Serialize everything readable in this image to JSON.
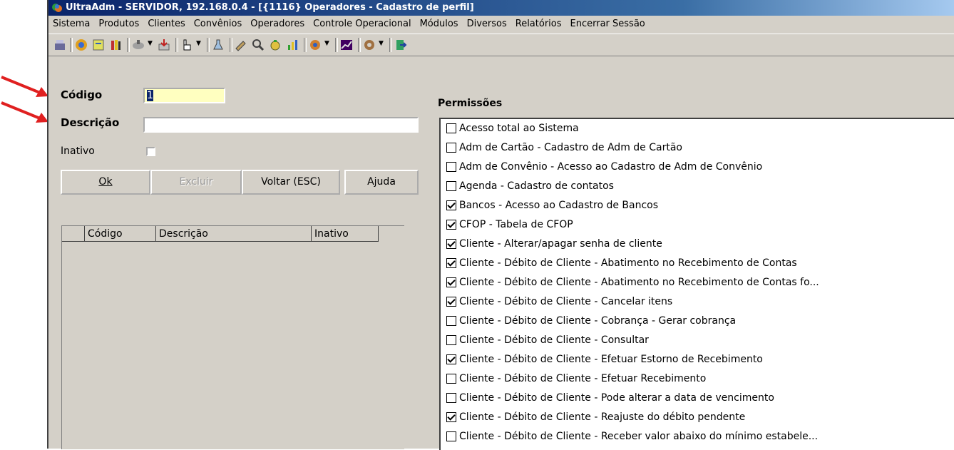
{
  "window": {
    "title": "UltraAdm - SERVIDOR, 192.168.0.4 - [{1116} Operadores - Cadastro de perfil]"
  },
  "menu": [
    "Sistema",
    "Produtos",
    "Clientes",
    "Convênios",
    "Operadores",
    "Controle Operacional",
    "Módulos",
    "Diversos",
    "Relatórios",
    "Encerrar Sessão"
  ],
  "form": {
    "codigo_label": "Código",
    "codigo_value": "1",
    "descricao_label": "Descrição",
    "descricao_value": "",
    "inativo_label": "Inativo",
    "inativo_checked": false
  },
  "buttons": {
    "ok": "Ok",
    "excluir": "Excluir",
    "voltar": "Voltar (ESC)",
    "ajuda": "Ajuda"
  },
  "grid": {
    "columns": [
      "Código",
      "Descrição",
      "Inativo"
    ]
  },
  "permissions": {
    "title": "Permissões",
    "items": [
      {
        "label": "Acesso total ao Sistema",
        "checked": false
      },
      {
        "label": "Adm de Cartão - Cadastro de Adm de Cartão",
        "checked": false
      },
      {
        "label": "Adm de Convênio - Acesso ao Cadastro de Adm de Convênio",
        "checked": false
      },
      {
        "label": "Agenda - Cadastro de contatos",
        "checked": false
      },
      {
        "label": "Bancos -  Acesso ao Cadastro de Bancos",
        "checked": true
      },
      {
        "label": "CFOP - Tabela de CFOP",
        "checked": true
      },
      {
        "label": "Cliente - Alterar/apagar senha de cliente",
        "checked": true
      },
      {
        "label": "Cliente - Débito de Cliente - Abatimento no Recebimento de Contas",
        "checked": true
      },
      {
        "label": "Cliente - Débito de Cliente - Abatimento no Recebimento de Contas fo...",
        "checked": true
      },
      {
        "label": "Cliente - Débito de Cliente - Cancelar itens",
        "checked": true
      },
      {
        "label": "Cliente - Débito de Cliente - Cobrança - Gerar cobrança",
        "checked": false
      },
      {
        "label": "Cliente - Débito de Cliente - Consultar",
        "checked": false
      },
      {
        "label": "Cliente - Débito de Cliente - Efetuar Estorno de Recebimento",
        "checked": true
      },
      {
        "label": "Cliente - Débito de Cliente - Efetuar Recebimento",
        "checked": false
      },
      {
        "label": "Cliente - Débito de Cliente - Pode alterar a data de vencimento",
        "checked": false
      },
      {
        "label": "Cliente - Débito de Cliente - Reajuste do débito pendente",
        "checked": true
      },
      {
        "label": "Cliente - Débito de Cliente - Receber valor abaixo do mínimo estabele...",
        "checked": false
      }
    ]
  },
  "colors": {
    "window_bg": "#d4d0c8",
    "titlebar": "#0a246a",
    "codigo_field_bg": "#ffffc0",
    "arrow": "#e02020"
  }
}
